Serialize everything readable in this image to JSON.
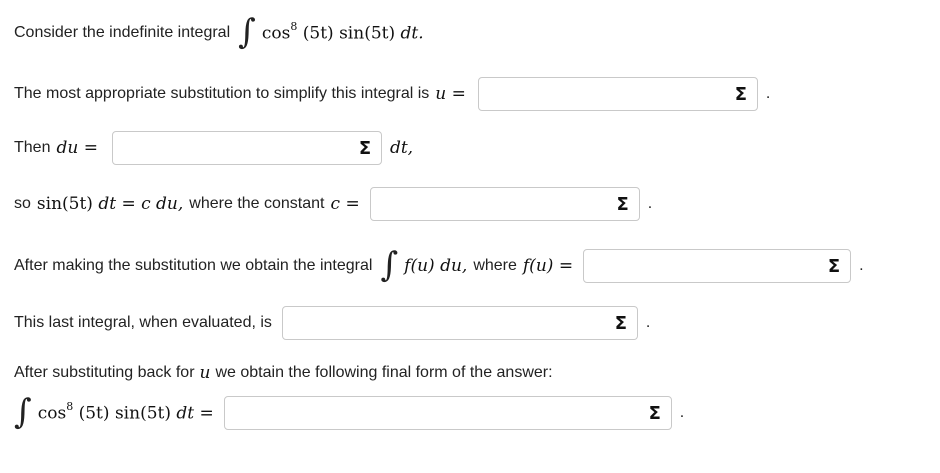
{
  "intro": {
    "text": "Consider the indefinite integral",
    "integrand_fn": "cos",
    "power": "8",
    "arg1": "(5t)",
    "fn2": "sin",
    "arg2": "(5t)",
    "d": "dt."
  },
  "q1": {
    "text": "The most appropriate substitution to simplify this integral is",
    "var": "u",
    "eq": "=",
    "after": "."
  },
  "q2": {
    "before": "Then",
    "var": "du",
    "eq": "=",
    "after": "dt,"
  },
  "q3": {
    "before": "so",
    "fn": "sin(5t)",
    "d": "dt",
    "eq": "=",
    "rhs": "c du,",
    "mid": "where the constant",
    "var": "c",
    "eq2": "=",
    "after": "."
  },
  "q4": {
    "before": "After making the substitution we obtain the integral",
    "f_expr": "f(u) du,",
    "mid": "where",
    "f_name": "f(u)",
    "eq": "=",
    "after": "."
  },
  "q5": {
    "text": "This last integral, when evaluated, is",
    "after": "."
  },
  "q6": {
    "text_a": "After substituting back for",
    "var": "u",
    "text_b": "we obtain the following final form of the answer:",
    "integrand_fn": "cos",
    "power": "8",
    "arg1": "(5t)",
    "fn2": "sin",
    "arg2": "(5t)",
    "d": "dt",
    "eq": "=",
    "after": "."
  },
  "icons": {
    "sigma": "Σ",
    "integral": "∫"
  }
}
